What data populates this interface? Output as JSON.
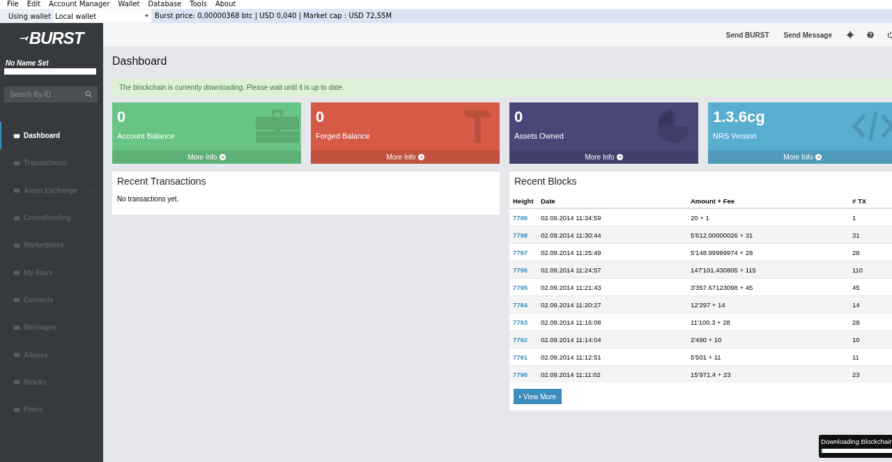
{
  "menu_bar": [
    "File",
    "Edit",
    "Account Manager",
    "Wallet",
    "Database",
    "Tools",
    "About"
  ],
  "wallet_bar": {
    "label": "Using wallet",
    "wallet": "Local wallet",
    "price": "Burst price: 0,00000368 btc | USD 0,040 | Market cap : USD 72,55M"
  },
  "sidebar": {
    "logo": "BURST",
    "account_name": "No Name Set",
    "search": {
      "placeholder": "Search By ID"
    },
    "items": [
      {
        "label": "Dashboard",
        "selected": true,
        "kind": "link"
      },
      {
        "label": "Transactions",
        "selected": false,
        "kind": "submenu"
      },
      {
        "label": "Asset Exchange",
        "selected": false,
        "kind": "submenu"
      },
      {
        "label": "Crowdfunding",
        "selected": false,
        "kind": "submenu"
      },
      {
        "label": "Marketplace",
        "selected": false,
        "kind": "submenu"
      },
      {
        "label": "My Store",
        "selected": false,
        "kind": "submenu"
      },
      {
        "label": "Contacts",
        "selected": false,
        "kind": "link"
      },
      {
        "label": "Messages",
        "selected": false,
        "kind": "link"
      },
      {
        "label": "Aliases",
        "selected": false,
        "kind": "link"
      },
      {
        "label": "Blocks",
        "selected": false,
        "kind": "link"
      },
      {
        "label": "Peers",
        "selected": false,
        "kind": "link"
      }
    ]
  },
  "header": {
    "actions": [
      "Send BURST",
      "Send Message"
    ]
  },
  "page_title": "Dashboard",
  "alert": "The blockchain is currently downloading. Please wait until it is up to date.",
  "stat_cards": [
    {
      "value": "0",
      "label": "Account Balance",
      "link": "More Info",
      "color": "#68c484"
    },
    {
      "value": "0",
      "label": "Forged Balance",
      "link": "More Info",
      "color": "#d65b47"
    },
    {
      "value": "0",
      "label": "Assets Owned",
      "link": "More Info",
      "color": "#4a4778"
    },
    {
      "value": "1.3.6cg",
      "label": "NRS Version",
      "link": "More Info",
      "color": "#59adcf"
    }
  ],
  "recent_transactions": {
    "title": "Recent Transactions",
    "empty_text": "No transactions yet."
  },
  "recent_blocks": {
    "title": "Recent Blocks",
    "columns": [
      "Height",
      "Date",
      "Amount + Fee",
      "# TX"
    ],
    "rows": [
      [
        "7799",
        "02.09.2014 11:34:59",
        "20 + 1",
        "1"
      ],
      [
        "7798",
        "02.09.2014 11:30:44",
        "5'612.00000026 + 31",
        "31"
      ],
      [
        "7797",
        "02.09.2014 11:25:49",
        "5'148.99999974 + 28",
        "28"
      ],
      [
        "7796",
        "02.09.2014 11:24:57",
        "147'101.430805 + 115",
        "110"
      ],
      [
        "7795",
        "02.09.2014 11:21:43",
        "3'357.67123098 + 45",
        "45"
      ],
      [
        "7794",
        "02.09.2014 11:20:27",
        "12'297 + 14",
        "14"
      ],
      [
        "7793",
        "02.09.2014 11:16:08",
        "11'100.3 + 28",
        "28"
      ],
      [
        "7792",
        "02.09.2014 11:14:04",
        "2'490 + 10",
        "10"
      ],
      [
        "7791",
        "02.09.2014 11:12:51",
        "5'501 + 11",
        "11"
      ],
      [
        "7790",
        "02.09.2014 11:11:02",
        "15'971.4 + 23",
        "23"
      ]
    ],
    "button": "View More"
  },
  "download_popup": {
    "title": "Downloading Blockchain",
    "level": 0.02
  }
}
